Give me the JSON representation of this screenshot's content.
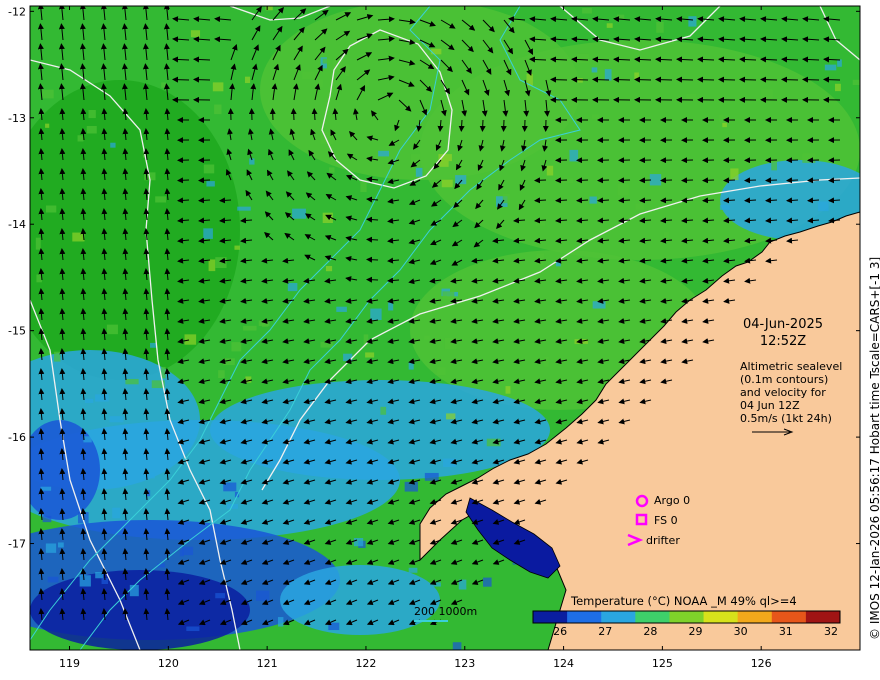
{
  "map": {
    "lon_ticks": [
      "119",
      "120",
      "121",
      "122",
      "123",
      "124",
      "125",
      "126"
    ],
    "lat_ticks": [
      "-12",
      "-13",
      "-14",
      "-15",
      "-16",
      "-17"
    ],
    "lon_range": [
      118.6,
      127.0
    ],
    "lat_range": [
      -18.0,
      -11.95
    ],
    "colors": {
      "land": "#f9c99b",
      "sea_warm": "#1fa81f",
      "sea_mid": "#4fc236",
      "sea_cool": "#2aa6e0",
      "sea_cold": "#0a1ea0",
      "contour": "#f0f0f0",
      "isobath": "#3ad0d8",
      "marker": "#ff00ff"
    }
  },
  "date": {
    "line1": "04-Jun-2025",
    "line2": "12:52Z"
  },
  "altimetry_note": {
    "line1": "Altimetric sealevel",
    "line2": "(0.1m contours)",
    "line3": "and velocity for",
    "line4": "04 Jun 12Z",
    "line5": "0.5m/s (1kt 24h)"
  },
  "legend": {
    "argo": "Argo 0",
    "fs": "FS 0",
    "drifter": "drifter"
  },
  "colorbar": {
    "title": "Temperature (°C) NOAA _M 49% ql>=4",
    "ticks": [
      "26",
      "27",
      "28",
      "29",
      "30",
      "31",
      "32"
    ],
    "colors": [
      "#0a1ea0",
      "#1e6ee6",
      "#2aa6e0",
      "#3ed06a",
      "#7fd22a",
      "#d7e21b",
      "#f2a81b",
      "#e6561a",
      "#a01414"
    ]
  },
  "bathymetry_scale": "200  1000m",
  "credit": "© IMOS 12-Jan-2026 05:56:17 Hobart time Tscale=CARS+[-1 3]"
}
